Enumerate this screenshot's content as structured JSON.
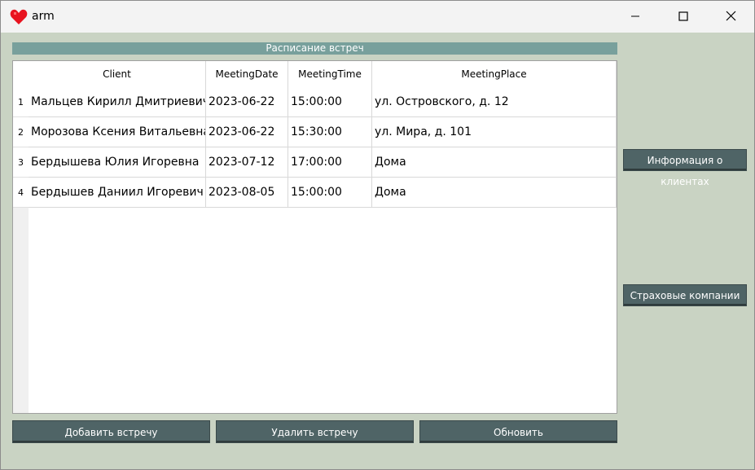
{
  "window": {
    "title": "arm"
  },
  "schedule": {
    "header": "Расписание встреч",
    "columns": [
      "Client",
      "MeetingDate",
      "MeetingTime",
      "MeetingPlace"
    ],
    "rows": [
      {
        "num": "1",
        "client": "Мальцев Кирилл Дмитриевич",
        "date": "2023-06-22",
        "time": "15:00:00",
        "place": "ул. Островского, д. 12"
      },
      {
        "num": "2",
        "client": "Морозова Ксения Витальевна",
        "date": "2023-06-22",
        "time": "15:30:00",
        "place": "ул. Мира, д. 101"
      },
      {
        "num": "3",
        "client": "Бердышева Юлия Игоревна",
        "date": "2023-07-12",
        "time": "17:00:00",
        "place": "Дома"
      },
      {
        "num": "4",
        "client": "Бердышев Даниил Игоревич",
        "date": "2023-08-05",
        "time": "15:00:00",
        "place": "Дома"
      }
    ]
  },
  "side_buttons": {
    "clients_info": "Информация о клиентах",
    "insurance_companies": "Страховые компании"
  },
  "bottom_buttons": {
    "add_meeting": "Добавить встречу",
    "delete_meeting": "Удалить встречу",
    "refresh": "Обновить"
  },
  "colors": {
    "window_bg": "#c9d3c3",
    "header_bar": "#78a09c",
    "button_bg": "#4f6466",
    "icon_red": "#e8131f"
  },
  "icons": {
    "app": "heart-icon",
    "minimize": "minimize-icon",
    "maximize": "maximize-icon",
    "close": "close-icon"
  }
}
